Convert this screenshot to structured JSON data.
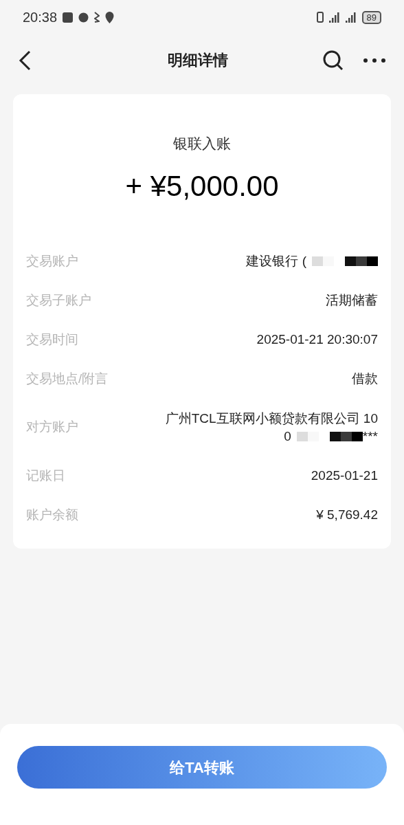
{
  "status_bar": {
    "time": "20:38",
    "battery": "89"
  },
  "header": {
    "title": "明细详情"
  },
  "summary": {
    "type": "银联入账",
    "amount": "+ ¥5,000.00"
  },
  "rows": [
    {
      "label": "交易账户",
      "lines": [
        [
          {
            "kind": "text",
            "text": "建设银行 ("
          },
          {
            "kind": "mask"
          }
        ]
      ]
    },
    {
      "label": "交易子账户",
      "lines": [
        [
          {
            "kind": "text",
            "text": "活期储蓄"
          }
        ]
      ]
    },
    {
      "label": "交易时间",
      "lines": [
        [
          {
            "kind": "text",
            "text": "2025-01-21 20:30:07"
          }
        ]
      ]
    },
    {
      "label": "交易地点/附言",
      "lines": [
        [
          {
            "kind": "text",
            "text": "借款"
          }
        ]
      ]
    },
    {
      "label": "对方账户",
      "lines": [
        [
          {
            "kind": "text",
            "text": "广州TCL互联网小额贷款有限公司 10"
          }
        ],
        [
          {
            "kind": "text",
            "text": "0"
          },
          {
            "kind": "mask"
          },
          {
            "kind": "text",
            "text": "***"
          }
        ]
      ]
    },
    {
      "label": "记账日",
      "lines": [
        [
          {
            "kind": "text",
            "text": "2025-01-21"
          }
        ]
      ]
    },
    {
      "label": "账户余额",
      "lines": [
        [
          {
            "kind": "text",
            "text": "¥ 5,769.42"
          }
        ]
      ]
    }
  ],
  "action": {
    "label": "给TA转账"
  }
}
